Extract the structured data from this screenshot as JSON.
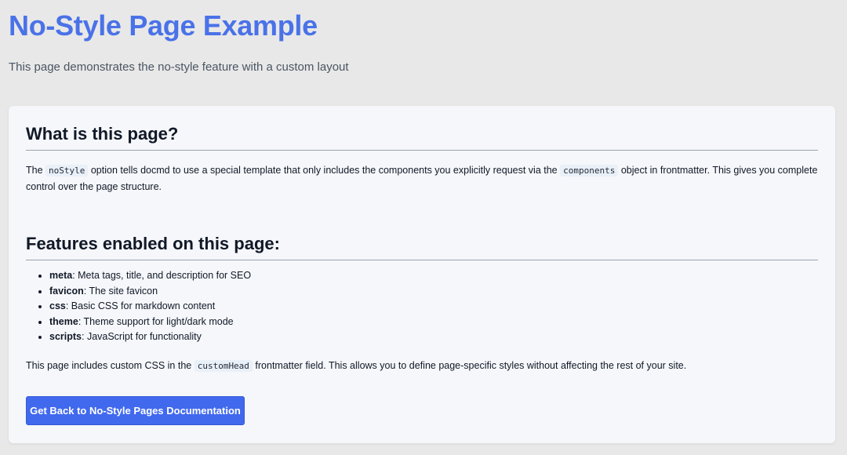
{
  "header": {
    "title": "No-Style Page Example",
    "subtitle": "This page demonstrates the no-style feature with a custom layout"
  },
  "section_what": {
    "heading": "What is this page?",
    "p_before_code1": "The ",
    "code1": "noStyle",
    "p_between": " option tells docmd to use a special template that only includes the components you explicitly request via the ",
    "code2": "components",
    "p_after": " object in frontmatter. This gives you complete control over the page structure."
  },
  "section_features": {
    "heading": "Features enabled on this page:",
    "items": [
      {
        "name": "meta",
        "desc": ": Meta tags, title, and description for SEO"
      },
      {
        "name": "favicon",
        "desc": ": The site favicon"
      },
      {
        "name": "css",
        "desc": ": Basic CSS for markdown content"
      },
      {
        "name": "theme",
        "desc": ": Theme support for light/dark mode"
      },
      {
        "name": "scripts",
        "desc": ": JavaScript for functionality"
      }
    ],
    "p_before_code": "This page includes custom CSS in the ",
    "code": "customHead",
    "p_after": " frontmatter field. This allows you to define page-specific styles without affecting the rest of your site."
  },
  "cta": {
    "label": "Get Back to No-Style Pages Documentation"
  },
  "colors": {
    "title": "#4a72e8",
    "button": "#4169ee",
    "background": "#e8e8e8",
    "card": "#f5f7fa"
  }
}
